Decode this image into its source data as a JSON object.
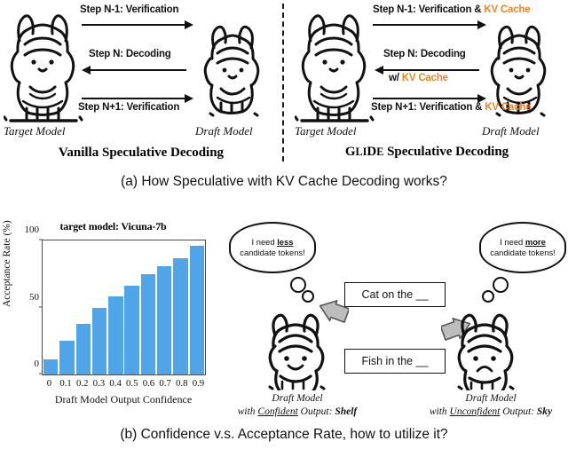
{
  "figure": {
    "panel_a": {
      "caption": "(a) How Speculative with KV Cache Decoding works?",
      "left": {
        "title_plain": "Vanilla Speculative Decoding",
        "target_label": "Target Model",
        "draft_label": "Draft Model",
        "arrows": [
          {
            "text": "Step N-1: Verification",
            "direction": "right"
          },
          {
            "text": "Step N: Decoding",
            "direction": "left"
          },
          {
            "text": "Step N+1: Verification",
            "direction": "right"
          }
        ]
      },
      "right": {
        "title_parts": [
          "G",
          "LI",
          "D",
          "E"
        ],
        "title_suffix": " Speculative Decoding",
        "target_label": "Target Model",
        "draft_label": "Draft Model",
        "arrows": [
          {
            "text": "Step N-1: Verification & ",
            "highlight": "KV Cache",
            "direction": "right"
          },
          {
            "text": "Step N: Decoding",
            "sub_prefix": "w/ ",
            "sub_highlight": "KV Cache",
            "direction": "left"
          },
          {
            "text": "Step N+1: Verification & ",
            "highlight": "KV Cache",
            "direction": "right"
          }
        ]
      }
    },
    "panel_b": {
      "caption": "(b) Confidence v.s. Acceptance Rate, how to utilize it?",
      "left_bubble_line1_pre": "I need ",
      "left_bubble_line1_em": "less",
      "left_bubble_line2": "candidate tokens!",
      "right_bubble_line1_pre": "I need ",
      "right_bubble_line1_em": "more",
      "right_bubble_line2": "candidate tokens!",
      "prompt_top": "Cat on the __",
      "prompt_bottom": "Fish in the __",
      "left_model": {
        "line1": "Draft Model",
        "line2_pre": "with ",
        "line2_em": "Confident",
        "line2_mid": " Output: ",
        "line2_out": "Shelf"
      },
      "right_model": {
        "line1": "Draft Model",
        "line2_pre": "with ",
        "line2_em": "Unconfident",
        "line2_mid": " Output: ",
        "line2_out": "Sky"
      }
    }
  },
  "chart_data": {
    "type": "bar",
    "title": "target model: Vicuna-7b",
    "xlabel": "Draft Model Output Confidence",
    "ylabel": "Acceptance Rate (%)",
    "categories": [
      "0",
      "0.1",
      "0.2",
      "0.3",
      "0.4",
      "0.5",
      "0.6",
      "0.7",
      "0.8",
      "0.9"
    ],
    "values": [
      11,
      25,
      38,
      50,
      58,
      66,
      75,
      81,
      87,
      96
    ],
    "ylim": [
      0,
      100
    ],
    "yticks": [
      0,
      50,
      100
    ],
    "grid": false,
    "legend": null,
    "bar_color": "#4FA5E8"
  },
  "colors": {
    "accent_orange": "#F08322",
    "bar_blue": "#4FA5E8",
    "ink": "#111111",
    "arrow_grey": "#B8B8B8"
  }
}
